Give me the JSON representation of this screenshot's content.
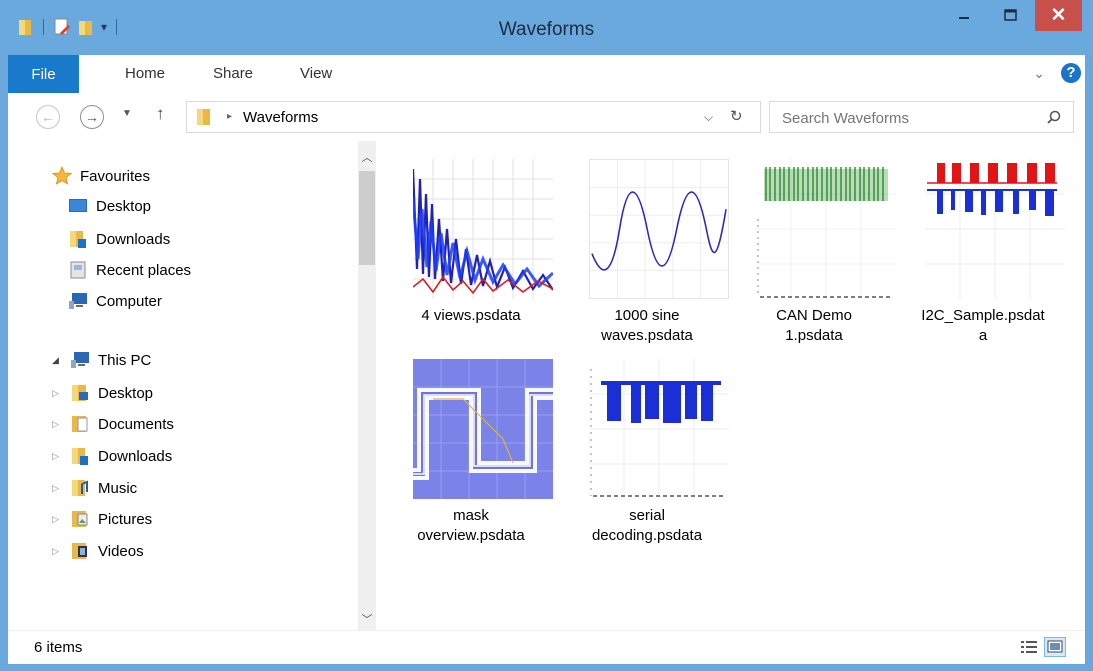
{
  "window": {
    "title": "Waveforms",
    "close_label": "✕"
  },
  "ribbon": {
    "tabs": [
      "File",
      "Home",
      "Share",
      "View"
    ]
  },
  "address": {
    "path": "Waveforms",
    "search_placeholder": "Search Waveforms"
  },
  "nav": {
    "favourites": {
      "label": "Favourites",
      "items": [
        "Desktop",
        "Downloads",
        "Recent places",
        "Computer"
      ]
    },
    "this_pc": {
      "label": "This PC",
      "items": [
        "Desktop",
        "Documents",
        "Downloads",
        "Music",
        "Pictures",
        "Videos"
      ]
    }
  },
  "files": [
    {
      "name_line1": "4 views.psdata",
      "name_line2": ""
    },
    {
      "name_line1": "1000 sine",
      "name_line2": "waves.psdata"
    },
    {
      "name_line1": "CAN Demo",
      "name_line2": "1.psdata"
    },
    {
      "name_line1": "I2C_Sample.psdat",
      "name_line2": "a"
    },
    {
      "name_line1": "mask",
      "name_line2": "overview.psdata"
    },
    {
      "name_line1": "serial",
      "name_line2": "decoding.psdata"
    }
  ],
  "status": {
    "item_count": "6 items"
  },
  "colors": {
    "titlebar": "#6aa9de",
    "file_tab": "#1979ca",
    "close_button": "#c7504a"
  }
}
